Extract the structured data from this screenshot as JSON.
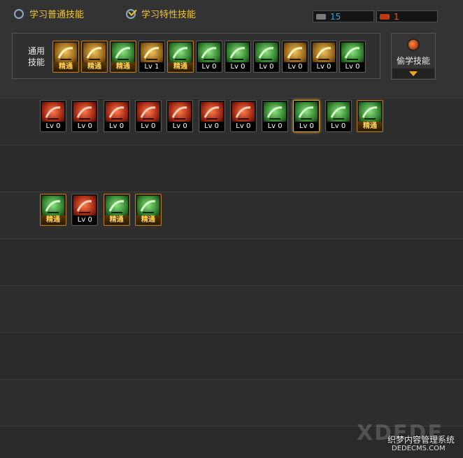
{
  "tabs": {
    "normal_label": "学习普通技能",
    "special_label": "学习特性技能"
  },
  "currency": {
    "sp_value": "15",
    "tp_value": "1"
  },
  "panel": {
    "label": "通用\n技能"
  },
  "steal": {
    "label": "偷学技能"
  },
  "common_skills": [
    {
      "tag": "精通",
      "kind": "gold"
    },
    {
      "tag": "精通",
      "kind": "gold"
    },
    {
      "tag": "精通",
      "kind": "green"
    },
    {
      "tag": "Lv 1",
      "kind": "gold"
    },
    {
      "tag": "精通",
      "kind": "green"
    },
    {
      "tag": "Lv 0",
      "kind": "green"
    },
    {
      "tag": "Lv 0",
      "kind": "green"
    },
    {
      "tag": "Lv 0",
      "kind": "green"
    },
    {
      "tag": "Lv 0",
      "kind": "gold"
    },
    {
      "tag": "Lv 0",
      "kind": "gold"
    },
    {
      "tag": "Lv 0",
      "kind": "green"
    }
  ],
  "row1": [
    {
      "tag": "Lv 0",
      "kind": "red"
    },
    {
      "tag": "Lv 0",
      "kind": "red"
    },
    {
      "tag": "Lv 0",
      "kind": "red"
    },
    {
      "tag": "Lv 0",
      "kind": "red"
    },
    {
      "tag": "Lv 0",
      "kind": "red"
    },
    {
      "tag": "Lv 0",
      "kind": "red"
    },
    {
      "tag": "Lv 0",
      "kind": "red"
    },
    {
      "tag": "Lv 0",
      "kind": "green"
    },
    {
      "tag": "Lv 0",
      "kind": "green",
      "selected": true
    },
    {
      "tag": "Lv 0",
      "kind": "green"
    },
    {
      "tag": "精通",
      "kind": "green"
    }
  ],
  "row2": [
    {
      "tag": "精通",
      "kind": "green"
    },
    {
      "tag": "Lv 0",
      "kind": "red"
    },
    {
      "tag": "精通",
      "kind": "green"
    },
    {
      "tag": "精通",
      "kind": "green"
    }
  ],
  "watermark": {
    "big": "XDEDE",
    "cn": "织梦内容管理系统",
    "url": "DEDECMS.COM"
  },
  "colors": {
    "accent": "#f1c434",
    "sp": "#2aa8e8",
    "tp": "#f05a2a"
  }
}
